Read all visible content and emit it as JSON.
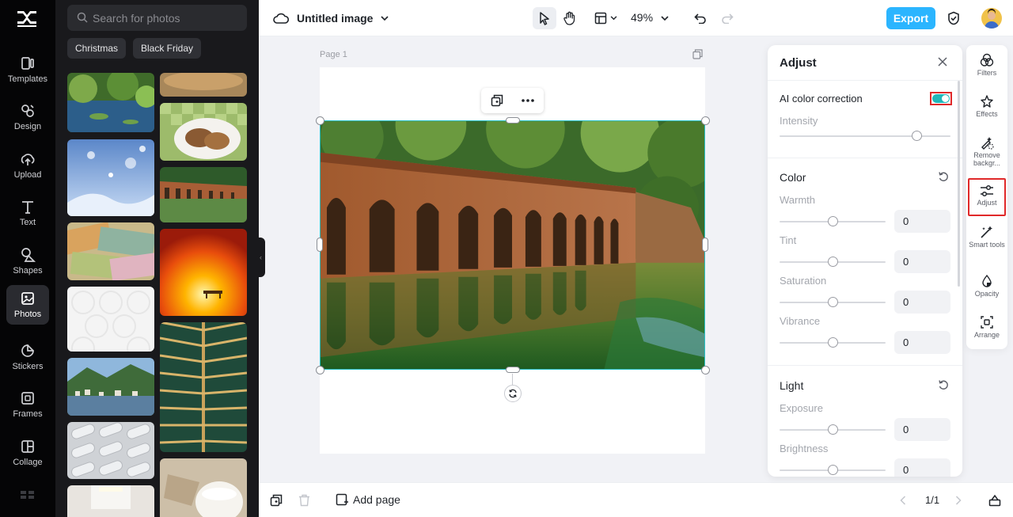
{
  "nav": {
    "items": [
      {
        "label": "Templates",
        "icon": "templates-icon"
      },
      {
        "label": "Design",
        "icon": "design-icon"
      },
      {
        "label": "Upload",
        "icon": "upload-icon"
      },
      {
        "label": "Text",
        "icon": "text-icon"
      },
      {
        "label": "Shapes",
        "icon": "shapes-icon"
      },
      {
        "label": "Photos",
        "icon": "photos-icon",
        "active": true
      },
      {
        "label": "Stickers",
        "icon": "stickers-icon"
      },
      {
        "label": "Frames",
        "icon": "frames-icon"
      },
      {
        "label": "Collage",
        "icon": "collage-icon"
      }
    ]
  },
  "photos_panel": {
    "search_placeholder": "Search for photos",
    "chips": [
      "Christmas",
      "Black Friday"
    ]
  },
  "topbar": {
    "title": "Untitled image",
    "zoom": "49%",
    "export_label": "Export"
  },
  "canvas": {
    "page_label": "Page 1"
  },
  "bottombar": {
    "add_page_label": "Add page",
    "page_count": "1/1"
  },
  "adjust_panel": {
    "title": "Adjust",
    "ai_color_correction": {
      "label": "AI color correction",
      "enabled": true
    },
    "intensity": {
      "label": "Intensity",
      "value": 0.8
    },
    "color": {
      "title": "Color",
      "controls": [
        {
          "label": "Warmth",
          "value": "0"
        },
        {
          "label": "Tint",
          "value": "0"
        },
        {
          "label": "Saturation",
          "value": "0"
        },
        {
          "label": "Vibrance",
          "value": "0"
        }
      ]
    },
    "light": {
      "title": "Light",
      "controls": [
        {
          "label": "Exposure",
          "value": "0"
        },
        {
          "label": "Brightness",
          "value": "0"
        }
      ]
    }
  },
  "right_tools": [
    {
      "label": "Filters",
      "icon": "filters-icon"
    },
    {
      "label": "Effects",
      "icon": "effects-icon"
    },
    {
      "label": "Remove backgr...",
      "icon": "remove-background-icon"
    },
    {
      "label": "Adjust",
      "icon": "adjust-icon",
      "active": true
    },
    {
      "label": "Smart tools",
      "icon": "smart-tools-icon"
    },
    {
      "label": "Opacity",
      "icon": "opacity-icon"
    },
    {
      "label": "Arrange",
      "icon": "arrange-icon"
    }
  ],
  "colors": {
    "accent": "#2bb5ff",
    "selection": "#27c0c6",
    "highlight": "#e0292a"
  }
}
